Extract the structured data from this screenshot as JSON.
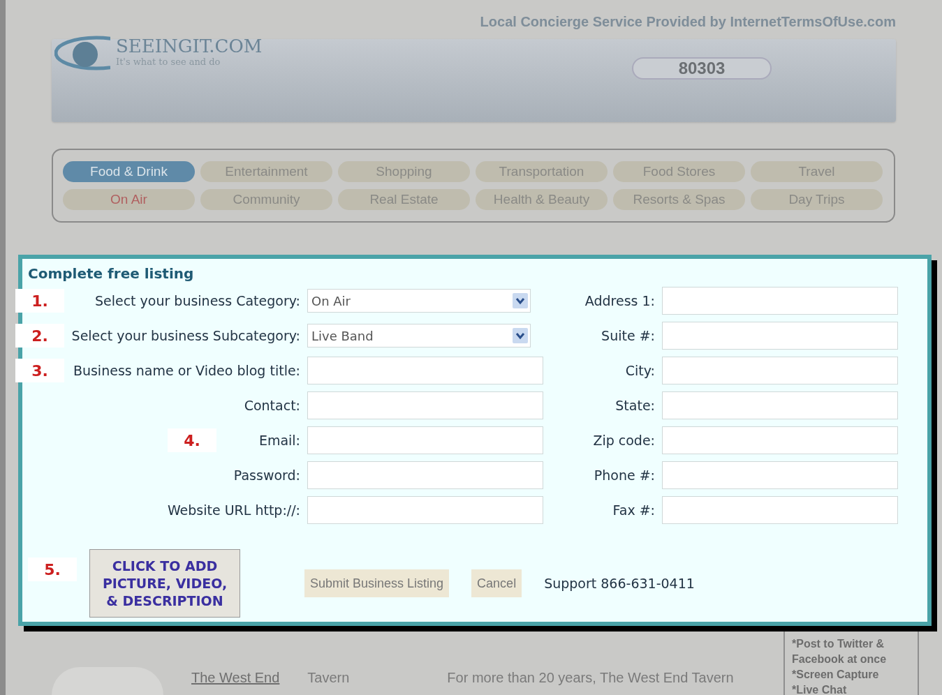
{
  "header": {
    "logo_name": "SEEINGIT.COM",
    "logo_tagline": "It's what to see and do",
    "provider": "Local Concierge Service Provided by InternetTermsOfUse.com",
    "zip": "80303"
  },
  "nav": {
    "rows": [
      [
        {
          "label": "Food & Drink",
          "selected": true,
          "highlighted": false
        },
        {
          "label": "Entertainment",
          "selected": false,
          "highlighted": false
        },
        {
          "label": "Shopping",
          "selected": false,
          "highlighted": false
        },
        {
          "label": "Transportation",
          "selected": false,
          "highlighted": false
        },
        {
          "label": "Food Stores",
          "selected": false,
          "highlighted": false
        },
        {
          "label": "Travel",
          "selected": false,
          "highlighted": false
        }
      ],
      [
        {
          "label": "On Air",
          "selected": false,
          "highlighted": true
        },
        {
          "label": "Community",
          "selected": false,
          "highlighted": false
        },
        {
          "label": "Real Estate",
          "selected": false,
          "highlighted": false
        },
        {
          "label": "Health & Beauty",
          "selected": false,
          "highlighted": false
        },
        {
          "label": "Resorts & Spas",
          "selected": false,
          "highlighted": false
        },
        {
          "label": "Day Trips",
          "selected": false,
          "highlighted": false
        }
      ]
    ]
  },
  "listing": {
    "name": "The West End",
    "type": "Tavern",
    "description": "For more than 20 years, The West End Tavern"
  },
  "sidebar": {
    "lines": [
      "*Post to Twitter &",
      "Facebook at once",
      "*Screen Capture",
      "*Live Chat"
    ]
  },
  "dialog": {
    "title": "Complete free listing",
    "left_fields": [
      {
        "step": "1.",
        "label": "Select your business Category:",
        "kind": "select",
        "value": "On Air"
      },
      {
        "step": "2.",
        "label": "Select your business Subcategory:",
        "kind": "select",
        "value": "Live Band"
      },
      {
        "step": "3.",
        "label": "Business name or Video blog title:",
        "kind": "text"
      },
      {
        "label": "Contact:",
        "kind": "text"
      },
      {
        "step": "4.",
        "label": "Email:",
        "kind": "text"
      },
      {
        "label": "Password:",
        "kind": "text"
      },
      {
        "label": "Website URL http://:",
        "kind": "text"
      }
    ],
    "right_fields": [
      {
        "label": "Address 1:"
      },
      {
        "label": "Suite #:"
      },
      {
        "label": "City:"
      },
      {
        "label": "State:"
      },
      {
        "label": "Zip code:"
      },
      {
        "label": "Phone #:"
      },
      {
        "label": "Fax #:"
      }
    ],
    "step5": "5.",
    "add_button": "CLICK TO ADD PICTURE, VIDEO, & DESCRIPTION",
    "submit": "Submit Business Listing",
    "cancel": "Cancel",
    "support": "Support 866-631-0411"
  }
}
